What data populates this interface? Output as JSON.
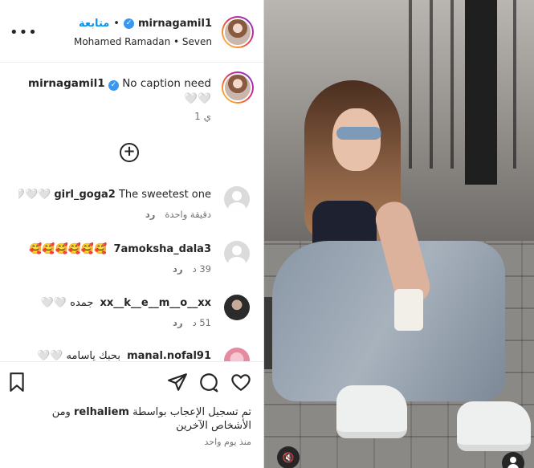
{
  "header": {
    "username": "mirnagamil1",
    "follow_label": "متابعة",
    "dot": "•",
    "audio": "Mohamed Ramadan • Seven",
    "more_icon": "more-dots-icon"
  },
  "caption": {
    "username": "mirnagamil1",
    "text": "No caption need 🤍🤍 ",
    "time": "1 ي"
  },
  "add_comment_icon": "plus-circle-icon",
  "comments": [
    {
      "username": "girl_goga2",
      "text": "The sweetest one🤍🤍🤍",
      "time": "دقيقة واحدة",
      "reply": "رد"
    },
    {
      "username": "7amoksha_dala3",
      "text": "🥰🥰🥰🥰🥰🥰",
      "time": "39 د",
      "reply": "رد"
    },
    {
      "username": "xx__k__e__m__o__xx",
      "text": "جمده 🤍🤍",
      "time": "51 د",
      "reply": "رد"
    },
    {
      "username": "manal.nofal91",
      "text": "بحبك ياسامه 🤍🤍",
      "time": "",
      "reply": ""
    }
  ],
  "actions": {
    "like_icon": "heart-icon",
    "comment_icon": "comment-bubble-icon",
    "share_icon": "send-icon",
    "save_icon": "bookmark-icon"
  },
  "likes": {
    "prefix": "تم تسجيل الإعجاب بواسطة",
    "username": "relhaliem",
    "suffix": "ومن الأشخاص الآخرين"
  },
  "posted": "منذ يوم واحد",
  "photo": {
    "mute_icon": "muted-speaker-icon",
    "tag_icon": "person-tag-icon"
  }
}
